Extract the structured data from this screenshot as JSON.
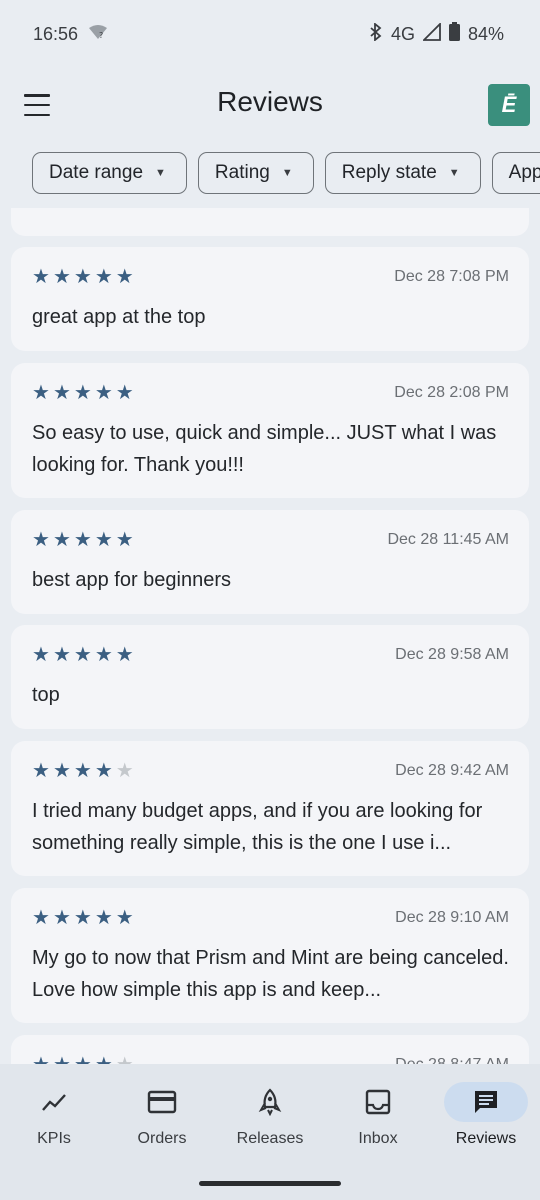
{
  "status": {
    "time": "16:56",
    "network": "4G",
    "battery": "84%"
  },
  "header": {
    "title": "Reviews",
    "app_icon_letter": "Ē"
  },
  "filters": [
    "Date range",
    "Rating",
    "Reply state",
    "App"
  ],
  "colors": {
    "star": "#3b5f82",
    "accent_chip": "#ccdcef",
    "app_icon": "#3a8f7d"
  },
  "reviews": [
    {
      "rating": 5,
      "date": "Dec 28 7:08 PM",
      "text": "great app at the top"
    },
    {
      "rating": 5,
      "date": "Dec 28 2:08 PM",
      "text": "So easy to use, quick and simple... JUST what I was looking for. Thank you!!!"
    },
    {
      "rating": 5,
      "date": "Dec 28 11:45 AM",
      "text": "best app for beginners"
    },
    {
      "rating": 5,
      "date": "Dec 28 9:58 AM",
      "text": "top"
    },
    {
      "rating": 4,
      "date": "Dec 28 9:42 AM",
      "text": "I tried many budget apps, and if you are looking for something really simple, this is the one I use i..."
    },
    {
      "rating": 5,
      "date": "Dec 28 9:10 AM",
      "text": "My go to now that Prism and Mint are being canceled. Love how simple this app is and keep..."
    },
    {
      "rating": 4,
      "date": "Dec 28 8:47 AM",
      "text": ""
    }
  ],
  "nav": [
    {
      "label": "KPIs",
      "icon": "chart-line-icon"
    },
    {
      "label": "Orders",
      "icon": "credit-card-icon"
    },
    {
      "label": "Releases",
      "icon": "rocket-icon"
    },
    {
      "label": "Inbox",
      "icon": "inbox-icon"
    },
    {
      "label": "Reviews",
      "icon": "comment-icon",
      "active": true
    }
  ]
}
